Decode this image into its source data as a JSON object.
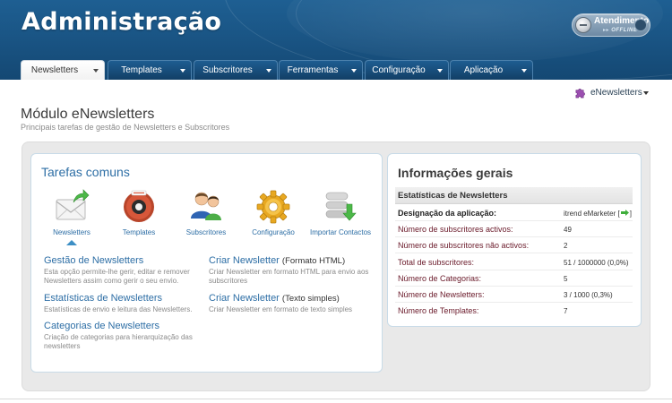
{
  "header": {
    "title": "Administração",
    "support": {
      "label": "Atendimento",
      "status": "OFFLINE"
    }
  },
  "tabs": [
    {
      "label": "Newsletters",
      "active": true
    },
    {
      "label": "Templates",
      "active": false
    },
    {
      "label": "Subscritores",
      "active": false
    },
    {
      "label": "Ferramentas",
      "active": false
    },
    {
      "label": "Configuração",
      "active": false
    },
    {
      "label": "Aplicação",
      "active": false
    }
  ],
  "module_selector": {
    "label": "eNewsletters",
    "icon": "puzzle-icon"
  },
  "page": {
    "title": "Módulo eNewsletters",
    "subtitle": "Principais tarefas de gestão de Newsletters e Subscritores"
  },
  "common_tasks": {
    "title": "Tarefas comuns",
    "actions": [
      {
        "label": "Newsletters",
        "icon": "envelope-icon",
        "selected": true
      },
      {
        "label": "Templates",
        "icon": "template-disc-icon",
        "selected": false
      },
      {
        "label": "Subscritores",
        "icon": "users-icon",
        "selected": false
      },
      {
        "label": "Configuração",
        "icon": "gear-icon",
        "selected": false
      },
      {
        "label": "Importar Contactos",
        "icon": "database-import-icon",
        "selected": false
      }
    ],
    "links": [
      {
        "title": "Gestão de Newsletters",
        "extra": "",
        "desc": [
          "Esta opção permite-lhe gerir, editar e remover",
          "Newsletters assim como gerir o seu envio."
        ]
      },
      {
        "title": "Criar Newsletter",
        "extra": "(Formato HTML)",
        "desc": [
          "Criar Newsletter em formato HTML para envio aos",
          "subscritores"
        ]
      },
      {
        "title": "Estatísticas de Newsletters",
        "extra": "",
        "desc": [
          "Estatísticas de envio e leitura das Newsletters."
        ]
      },
      {
        "title": "Criar Newsletter",
        "extra": "(Texto simples)",
        "desc": [
          "Criar Newsletter em formato de texto simples"
        ]
      },
      {
        "title": "Categorias de Newsletters",
        "extra": "",
        "desc": [
          "Criação de categorias para hierarquização das",
          "newsletters"
        ]
      }
    ]
  },
  "general_info": {
    "title": "Informações gerais",
    "table_header": "Estatísticas de Newsletters",
    "rows": [
      {
        "label": "Designação da aplicação:",
        "value": "itrend eMarketer [",
        "suffix": "]",
        "bold": true,
        "link": true
      },
      {
        "label": "Número de subscritores activos:",
        "value": "49",
        "suffix": "",
        "bold": false,
        "link": false
      },
      {
        "label": "Número de subscritores não activos:",
        "value": "2",
        "suffix": "",
        "bold": false,
        "link": false
      },
      {
        "label": "Total de subscritores:",
        "value": "51 / 1000000  (0,0%)",
        "suffix": "",
        "bold": false,
        "link": false
      },
      {
        "label": "Número de Categorias:",
        "value": "5",
        "suffix": "",
        "bold": false,
        "link": false
      },
      {
        "label": "Número de Newsletters:",
        "value": "3 / 1000  (0,3%)",
        "suffix": "",
        "bold": false,
        "link": false
      },
      {
        "label": "Número de Templates:",
        "value": "7",
        "suffix": "",
        "bold": false,
        "link": false
      }
    ]
  },
  "colors": {
    "header": "#1a5585",
    "link": "#2d6ea5",
    "panel": "#e9e9e9",
    "accent_green": "#3fae3b"
  }
}
